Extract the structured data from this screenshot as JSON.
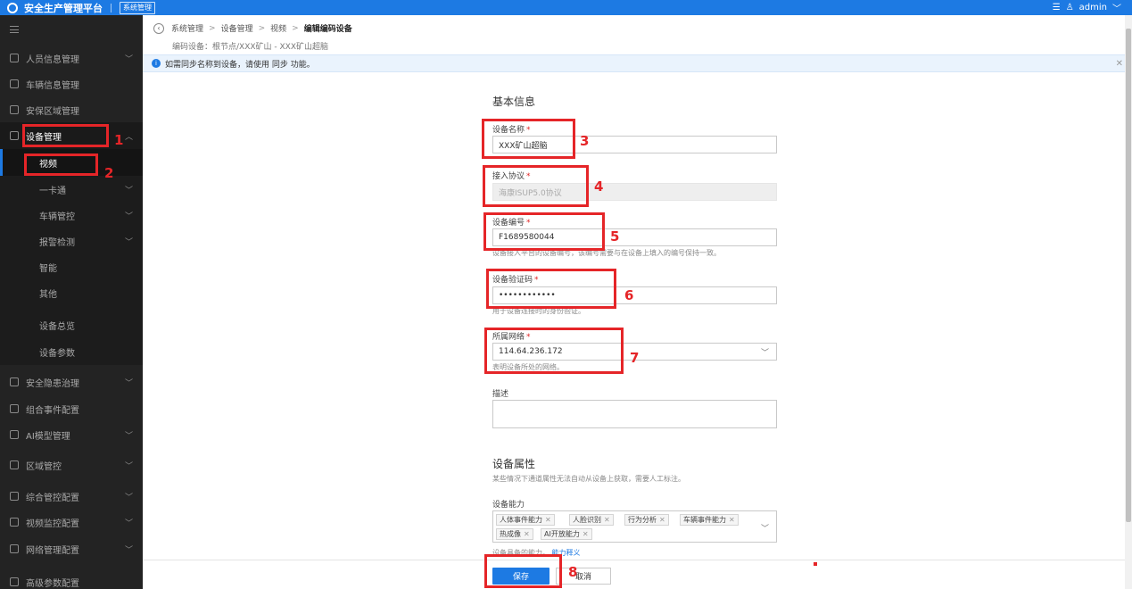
{
  "topbar": {
    "app_title": "安全生产管理平台",
    "tag": "系统管理",
    "user": "admin"
  },
  "sidebar": {
    "items": [
      {
        "label": "人员信息管理",
        "icon": "person-icon",
        "has_chevron": true
      },
      {
        "label": "车辆信息管理",
        "icon": "car-icon",
        "has_chevron": false
      },
      {
        "label": "安保区域管理",
        "icon": "area-icon",
        "has_chevron": false
      },
      {
        "label": "设备管理",
        "icon": "device-icon",
        "has_chevron": true,
        "expanded": true
      },
      {
        "label": "视频",
        "sub": true,
        "selected": true
      },
      {
        "label": "一卡通",
        "sub": true,
        "has_chevron": true
      },
      {
        "label": "车辆管控",
        "sub": true,
        "has_chevron": true
      },
      {
        "label": "报警检测",
        "sub": true,
        "has_chevron": true
      },
      {
        "label": "智能",
        "sub": true
      },
      {
        "label": "其他",
        "sub": true
      },
      {
        "label": "设备总览",
        "sub": true
      },
      {
        "label": "设备参数",
        "sub": true
      },
      {
        "label": "安全隐患治理",
        "icon": "shield-icon",
        "has_chevron": true
      },
      {
        "label": "组合事件配置",
        "icon": "event-icon",
        "has_chevron": false
      },
      {
        "label": "AI模型管理",
        "icon": "ai-icon",
        "has_chevron": true
      },
      {
        "label": "区域管控",
        "icon": "region-icon",
        "has_chevron": true
      },
      {
        "label": "综合管控配置",
        "icon": "grid-icon",
        "has_chevron": true
      },
      {
        "label": "视频监控配置",
        "icon": "camera-icon",
        "has_chevron": true
      },
      {
        "label": "网络管理配置",
        "icon": "network-icon",
        "has_chevron": true
      },
      {
        "label": "高级参数配置",
        "icon": "gear-icon",
        "has_chevron": false
      }
    ]
  },
  "breadcrumb": {
    "items": [
      "系统管理",
      "设备管理",
      "视频",
      "编辑编码设备"
    ],
    "subtitle": "编码设备：根节点/XXX矿山 - XXX矿山超脑"
  },
  "infobar": {
    "text": "如需同步名称到设备，请使用 同步 功能。"
  },
  "form": {
    "basic_title": "基本信息",
    "device_name_label": "设备名称",
    "device_name_value": "XXX矿山超脑",
    "protocol_label": "接入协议",
    "protocol_value": "海康ISUP5.0协议",
    "device_id_label": "设备编号",
    "device_id_value": "F1689580044",
    "device_id_hint": "设备接入平台的设备编号，该编号需要与在设备上填入的编号保持一致。",
    "verify_label": "设备验证码",
    "verify_value": "••••••••••••",
    "verify_hint": "用于设备连接时的身份验证。",
    "network_label": "所属网络",
    "network_value": "114.64.236.172",
    "network_hint": "表明设备所处的网络。",
    "desc_label": "描述",
    "attr_title": "设备属性",
    "attr_hint": "某些情况下通道属性无法自动从设备上获取，需要人工标注。",
    "capability_label": "设备能力",
    "capabilities": [
      "人体事件能力",
      "人脸识别",
      "行为分析",
      "车辆事件能力",
      "热成像",
      "AI开放能力"
    ],
    "capability_hint": "设备具备的能力。",
    "capability_link": "能力释义"
  },
  "footer": {
    "save_label": "保存",
    "cancel_label": "取消"
  },
  "annotations": [
    "1",
    "2",
    "3",
    "4",
    "5",
    "6",
    "7",
    "8"
  ],
  "colors": {
    "brand": "#1d7ae3",
    "annotation": "#e52528",
    "sidebar_bg": "#232323"
  }
}
